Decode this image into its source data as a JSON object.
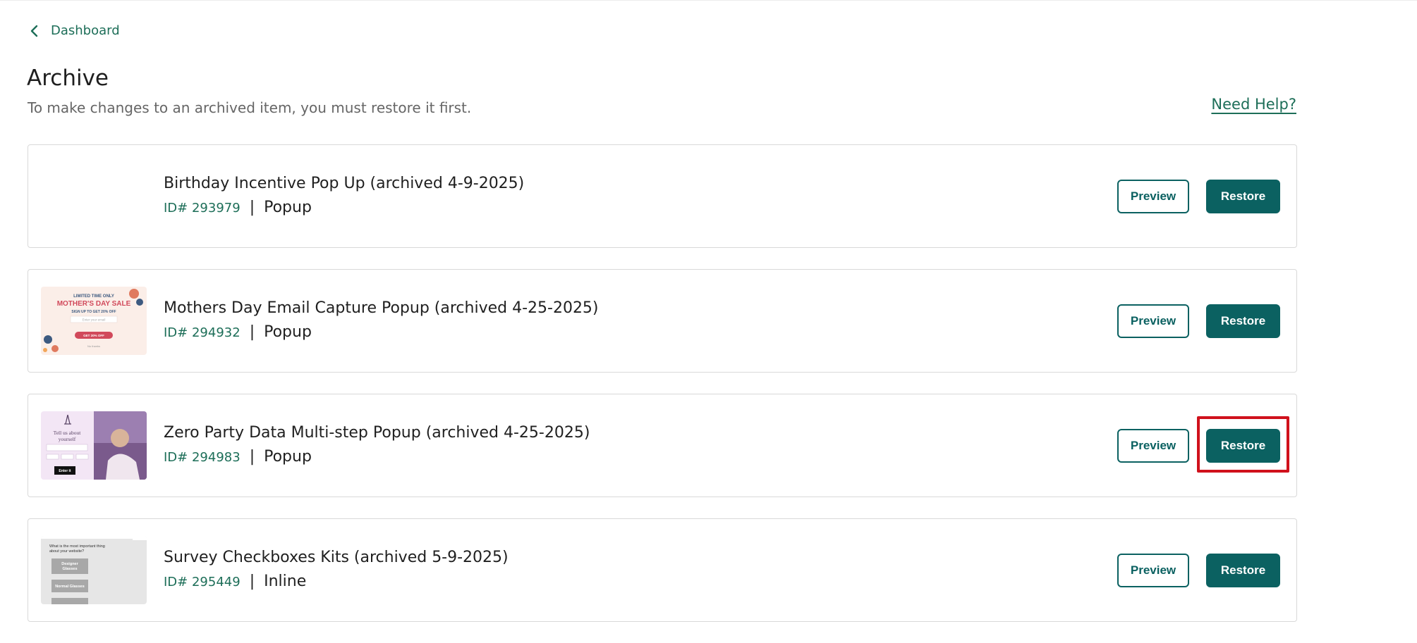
{
  "nav": {
    "back_label": "Dashboard"
  },
  "header": {
    "title": "Archive",
    "subtitle": "To make changes to an archived item, you must restore it first.",
    "help_label": "Need Help?"
  },
  "buttons": {
    "preview_label": "Preview",
    "restore_label": "Restore"
  },
  "items": [
    {
      "title": "Birthday Incentive Pop Up (archived 4-9-2025)",
      "id_label": "ID# 293979",
      "separator": "|",
      "type": "Popup",
      "thumbnail": "none"
    },
    {
      "title": "Mothers Day Email Capture Popup (archived 4-25-2025)",
      "id_label": "ID# 294932",
      "separator": "|",
      "type": "Popup",
      "thumbnail": "mothers-day-sale-popup",
      "thumb_text": {
        "line1": "LIMITED TIME ONLY",
        "line2": "MOTHER'S DAY SALE",
        "line3": "SIGN UP TO GET 20% OFF",
        "field": "Enter your email",
        "cta": "GET 20% OFF",
        "decline": "No thanks"
      }
    },
    {
      "title": "Zero Party Data Multi-step Popup (archived 4-25-2025)",
      "id_label": "ID# 294983",
      "separator": "|",
      "type": "Popup",
      "thumbnail": "zero-party-data-popup",
      "thumb_text": {
        "line1": "Tell us about",
        "line2": "yourself",
        "cta": "Enter it"
      }
    },
    {
      "title": "Survey Checkboxes Kits (archived 5-9-2025)",
      "id_label": "ID# 295449",
      "separator": "|",
      "type": "Inline",
      "thumbnail": "survey-checkboxes",
      "thumb_text": {
        "question_line1": "What is the most important thing",
        "question_line2": "about your website?",
        "option1_line1": "Designer",
        "option1_line2": "Glasses",
        "option2": "Normal Glasses"
      }
    }
  ],
  "highlighted_item_index": 2,
  "colors": {
    "accent_green": "#1d6e58",
    "button_teal": "#0b6161",
    "highlight_red": "#d0111c",
    "border_gray": "#d9d9d9"
  }
}
